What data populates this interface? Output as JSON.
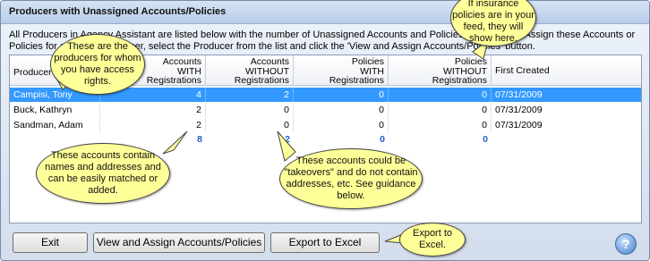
{
  "window": {
    "title": "Producers with Unassigned Accounts/Policies"
  },
  "intro_text": "All Producers in Agency Assistant are listed below with the number of Unassigned Accounts and Policies.  To View and Assign these Accounts or Policies for a specific Producer, select the Producer from the list and click the 'View and Assign Accounts/Policies' button.",
  "grid": {
    "columns": [
      "Producer",
      "Accounts WITH Registrations",
      "Accounts WITHOUT Registrations",
      "Policies WITH Registrations",
      "Policies WITHOUT Registrations",
      "First Created"
    ],
    "header_lines": {
      "producer": "Producer",
      "acc_with": [
        "Accounts",
        "WITH",
        "Registrations"
      ],
      "acc_without": [
        "Accounts",
        "WITHOUT",
        "Registrations"
      ],
      "pol_with": [
        "Policies",
        "WITH",
        "Registrations"
      ],
      "pol_without": [
        "Policies",
        "WITHOUT",
        "Registrations"
      ],
      "created": "First Created"
    },
    "rows": [
      {
        "producer": "Campisi, Tony",
        "acc_with": "4",
        "acc_without": "2",
        "pol_with": "0",
        "pol_without": "0",
        "created": "07/31/2009",
        "selected": true
      },
      {
        "producer": "Buck, Kathryn",
        "acc_with": "2",
        "acc_without": "0",
        "pol_with": "0",
        "pol_without": "0",
        "created": "07/31/2009",
        "selected": false
      },
      {
        "producer": "Sandman, Adam",
        "acc_with": "2",
        "acc_without": "0",
        "pol_with": "0",
        "pol_without": "0",
        "created": "07/31/2009",
        "selected": false
      }
    ],
    "totals": {
      "acc_with": "8",
      "acc_without": "2",
      "pol_with": "0",
      "pol_without": "0"
    }
  },
  "buttons": {
    "exit": "Exit",
    "view_assign": "View and Assign Accounts/Policies",
    "export": "Export to Excel",
    "help": "?"
  },
  "callouts": {
    "producers": "These are the producers for whom you have access rights.",
    "policies": "If insurance policies are in your feed, they will show here.",
    "accounts_with": "These accounts contain names and addresses and can be easily matched or added.",
    "accounts_without": "These accounts could be \"takeovers\" and do not contain addresses, etc. See guidance below.",
    "export": "Export to Excel."
  },
  "colors": {
    "selection": "#3399ff",
    "totals": "#1f5fc8",
    "callout_fill": "#ffff99"
  }
}
